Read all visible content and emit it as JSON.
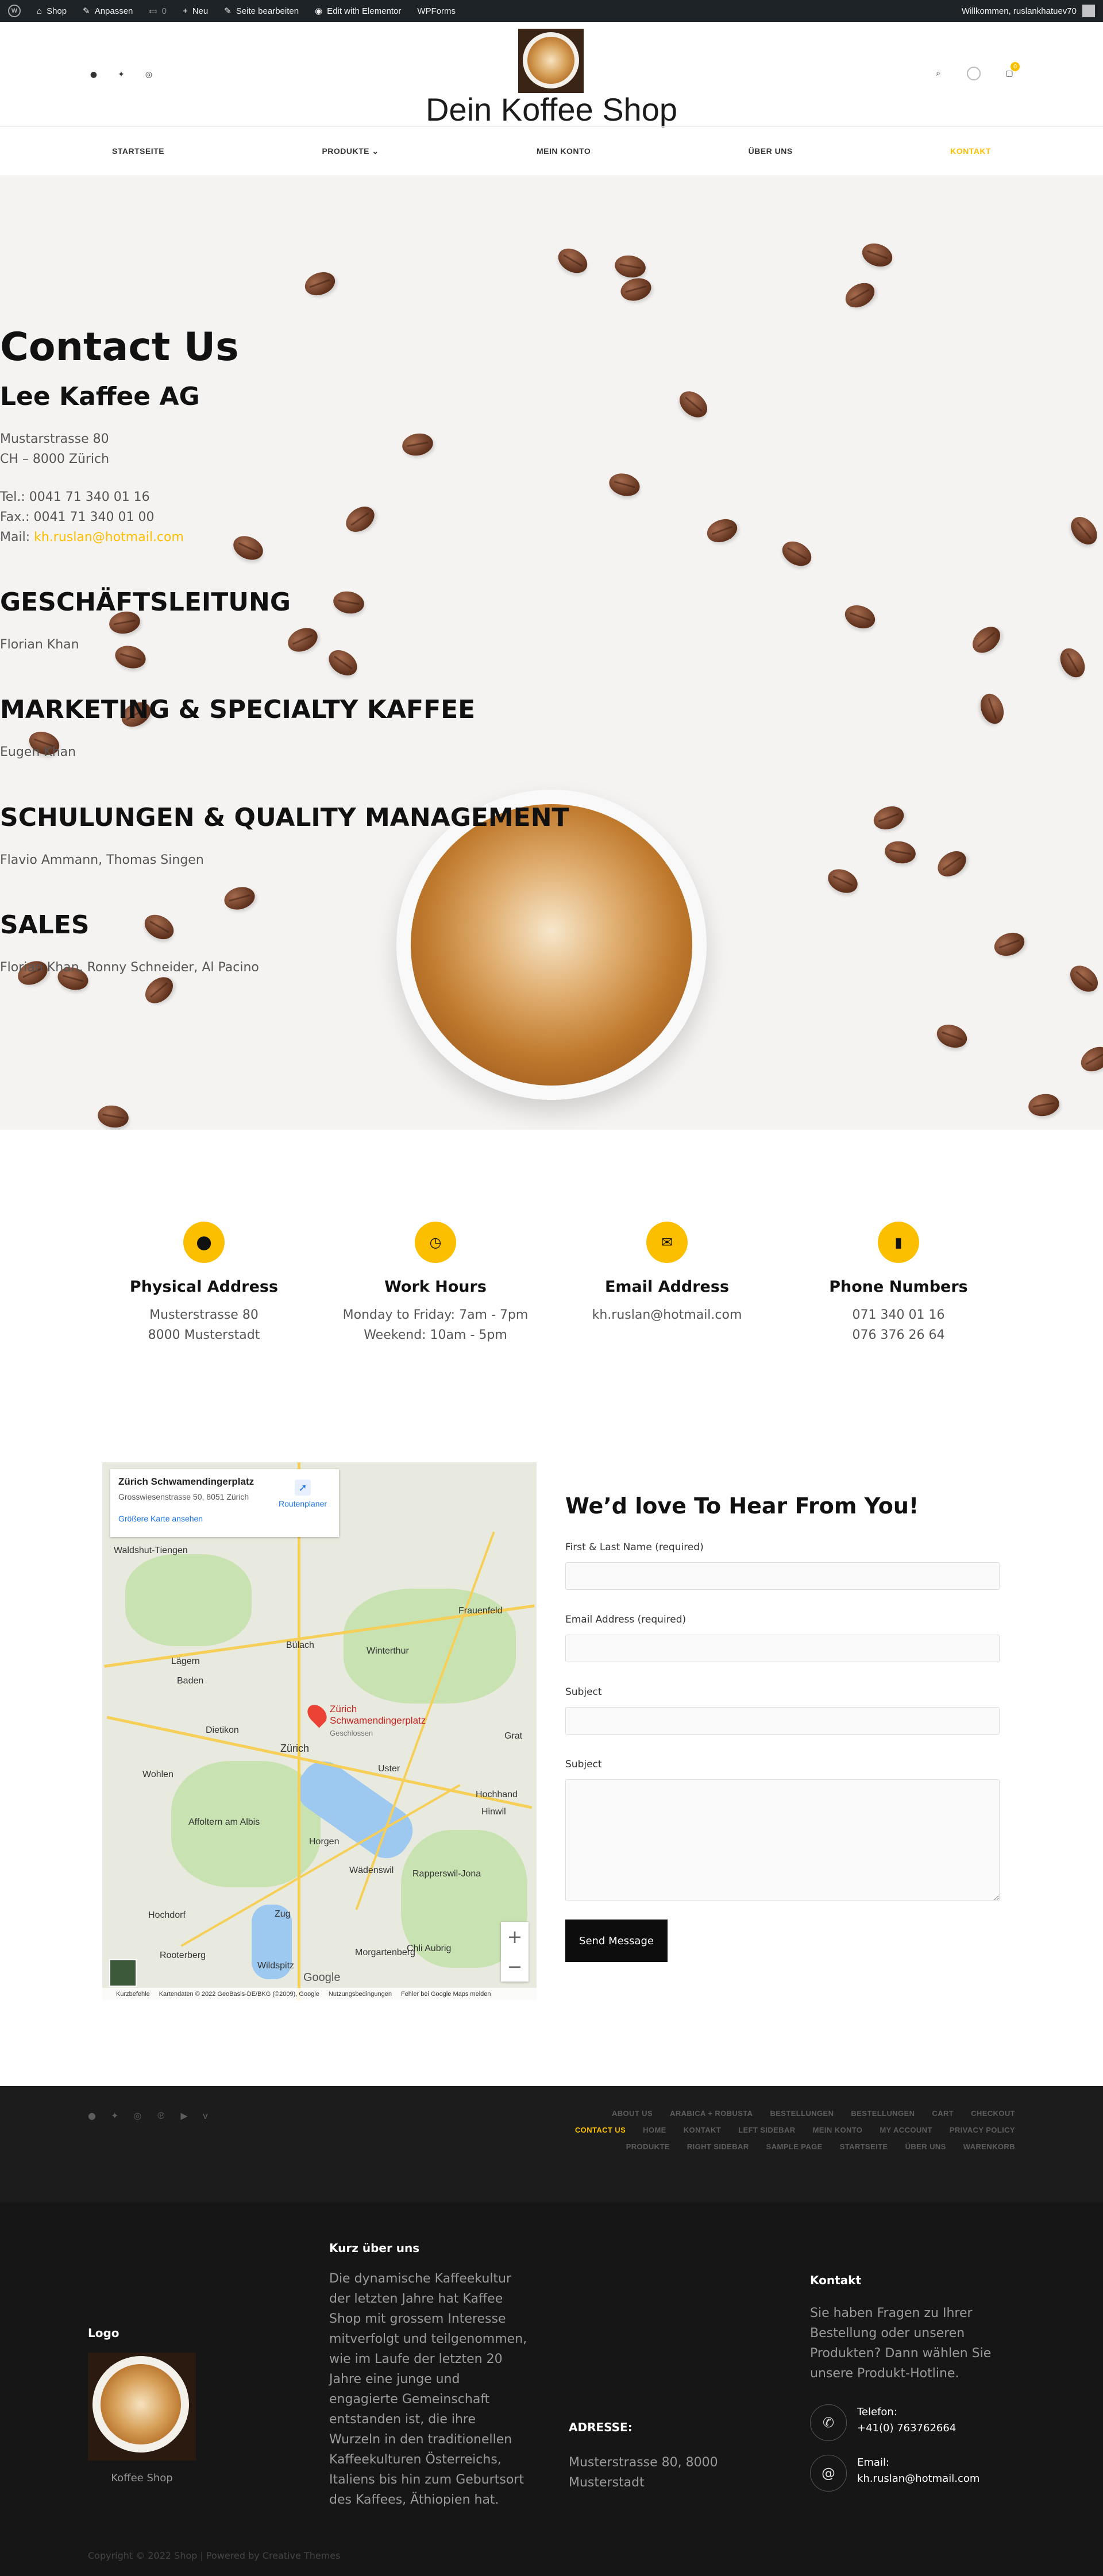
{
  "adminbar": {
    "items": [
      "Shop",
      "Anpassen",
      "0",
      "Neu",
      "Seite bearbeiten",
      "Edit with Elementor",
      "WPForms"
    ],
    "greeting": "Willkommen, ruslankhatuev70"
  },
  "header": {
    "site_title": "Dein Koffee Shop",
    "cart_count": "0",
    "nav": [
      "STARTSEITE",
      "PRODUKTE",
      "MEIN KONTO",
      "ÜBER UNS",
      "KONTAKT"
    ]
  },
  "hero": {
    "title": "Contact Us",
    "company": "Lee Kaffee AG",
    "street": "Mustarstrasse 80",
    "city": "CH – 8000 Zürich",
    "tel": "Tel.: 0041 71 340 01 16",
    "fax": "Fax.: 0041 71 340 01 00",
    "mail_label": "Mail:",
    "mail": "kh.ruslan@hotmail.com",
    "sections": [
      {
        "heading": "GESCHÄFTSLEITUNG",
        "names": "Florian Khan"
      },
      {
        "heading": "MARKETING & SPECIALTY KAFFEE",
        "names": "Eugen Khan"
      },
      {
        "heading": "SCHULUNGEN & QUALITY MANAGEMENT",
        "names": "Flavio Ammann, Thomas Singen"
      },
      {
        "heading": "SALES",
        "names": "Florian Khan, Ronny Schneider, Al Pacino"
      }
    ]
  },
  "info": [
    {
      "title": "Physical Address",
      "line1": "Musterstrasse 80",
      "line2": "8000 Musterstadt"
    },
    {
      "title": "Work Hours",
      "line1": "Monday to Friday: 7am - 7pm",
      "line2": "Weekend: 10am - 5pm"
    },
    {
      "title": "Email Address",
      "line1": "kh.ruslan@hotmail.com",
      "line2": ""
    },
    {
      "title": "Phone Numbers",
      "line1": "071 340 01 16",
      "line2": "076 376 26 64"
    }
  ],
  "map": {
    "place": "Zürich Schwamendingerplatz",
    "address": "Grosswiesenstrasse 50, 8051 Zürich",
    "larger_map": "Größere Karte ansehen",
    "route": "Routenplaner",
    "pin_label_1": "Zürich",
    "pin_label_2": "Schwamendingerplatz",
    "pin_sub": "Geschlossen",
    "cities": [
      "Waldshut-Tiengen",
      "Zürich",
      "Winterthur",
      "Baden",
      "Frauenfeld",
      "Uster",
      "Zug",
      "Lägern",
      "Bülach",
      "Dietikon",
      "Wohlen",
      "Rapperswil-Jona",
      "Hinwil",
      "Horgen",
      "Affoltern am Albis",
      "Hochdorf",
      "Wädenswil",
      "Grat",
      "Rooterberg",
      "Morgartenberg",
      "Wildspitz",
      "Chli Aubrig",
      "Hochhand"
    ],
    "attribution": [
      "Kurzbefehle",
      "Kartendaten © 2022 GeoBasis-DE/BKG (©2009), Google",
      "Nutzungsbedingungen",
      "Fehler bei Google Maps melden"
    ],
    "google": "Google"
  },
  "form": {
    "heading": "We’d love To Hear From You!",
    "name_label": "First & Last Name (required)",
    "email_label": "Email Address (required)",
    "subject_label": "Subject",
    "message_label": "Subject",
    "submit": "Send Message"
  },
  "footer_links": [
    "ABOUT US",
    "ARABICA + ROBUSTA",
    "BESTELLUNGEN",
    "BESTELLUNGEN",
    "CART",
    "CHECKOUT",
    "CONTACT US",
    "HOME",
    "KONTAKT",
    "LEFT SIDEBAR",
    "MEIN KONTO",
    "MY ACCOUNT",
    "PRIVACY POLICY",
    "PRODUKTE",
    "RIGHT SIDEBAR",
    "SAMPLE PAGE",
    "STARTSEITE",
    "ÜBER UNS",
    "WARENKORB"
  ],
  "footer": {
    "logo_heading": "Logo",
    "logo_caption": "Koffee Shop",
    "about_heading": "Kurz über uns",
    "about_text": "Die dynamische Kaffeekultur der letzten Jahre hat Kaffee Shop mit grossem Interesse mitverfolgt und teilgenommen, wie im Laufe der letzten 20 Jahre eine junge und engagierte Gemeinschaft entstanden ist, die ihre Wurzeln in den traditionellen Kaffeekulturen Österreichs, Italiens bis hin zum Geburtsort des Kaffees, Äthiopien hat.",
    "address_heading": "ADRESSE:",
    "address_text": "Musterstrasse 80, 8000 Musterstadt",
    "contact_heading": "Kontakt",
    "contact_text": "Sie haben Fragen zu Ihrer Bestellung oder unseren Produkten? Dann wählen Sie unsere Produkt-Hotline.",
    "phone_label": "Telefon:",
    "phone": "+41(0) 763762664",
    "email_label": "Email:",
    "email": "kh.ruslan@hotmail.com",
    "copyright": "Copyright © 2022 Shop | Powered by Creative Themes"
  },
  "colors": {
    "accent": "#fbbf00",
    "dark": "#1c1c1c",
    "adminbar": "#1d2327"
  }
}
